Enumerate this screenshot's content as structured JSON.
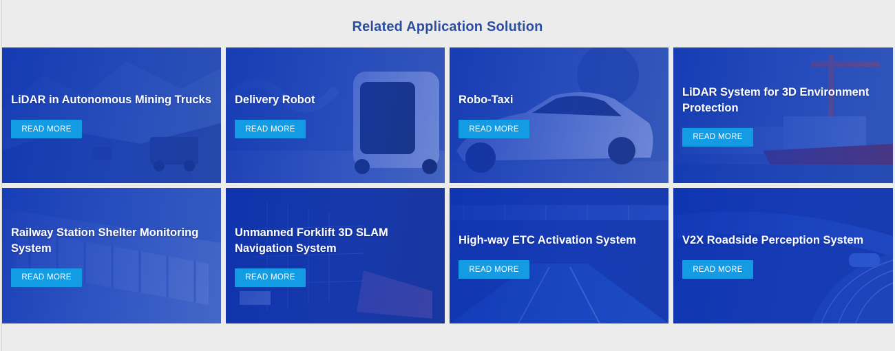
{
  "section": {
    "title": "Related Application Solution"
  },
  "cards": [
    {
      "title": "LiDAR in Autonomous Mining Trucks",
      "button": "READ MORE",
      "image": "mining-truck-image"
    },
    {
      "title": "Delivery Robot",
      "button": "READ MORE",
      "image": "delivery-robot-image"
    },
    {
      "title": "Robo-Taxi",
      "button": "READ MORE",
      "image": "robo-taxi-image"
    },
    {
      "title": "LiDAR System for 3D Environment Protection",
      "button": "READ MORE",
      "image": "port-ship-image"
    },
    {
      "title": "Railway Station Shelter Monitoring System",
      "button": "READ MORE",
      "image": "railway-shelter-image"
    },
    {
      "title": "Unmanned Forklift 3D SLAM Navigation System",
      "button": "READ MORE",
      "image": "forklift-slam-image"
    },
    {
      "title": "High-way ETC Activation System",
      "button": "READ MORE",
      "image": "highway-etc-image"
    },
    {
      "title": "V2X Roadside Perception System",
      "button": "READ MORE",
      "image": "v2x-road-image"
    }
  ],
  "colors": {
    "page_background": "#ececec",
    "title_text": "#2b4f9c",
    "card_overlay": "#1f3fae",
    "button_background": "#139ce3",
    "button_text": "#ffffff"
  }
}
